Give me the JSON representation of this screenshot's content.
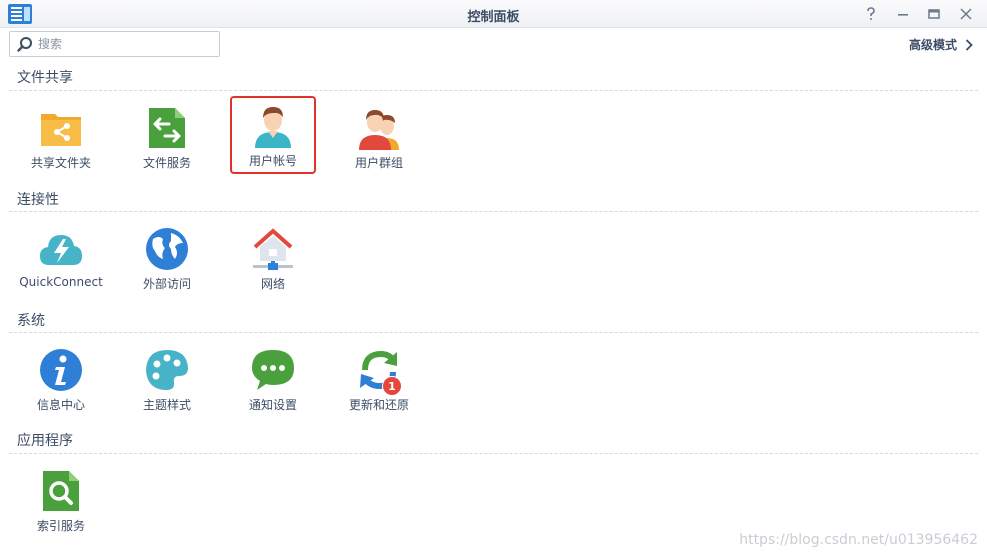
{
  "window": {
    "title": "控制面板"
  },
  "search": {
    "placeholder": "搜索"
  },
  "advanced_mode": {
    "label": "高级模式"
  },
  "sections": [
    {
      "title": "文件共享",
      "items": [
        {
          "label": "共享文件夹",
          "icon": "shared-folder-icon"
        },
        {
          "label": "文件服务",
          "icon": "file-services-icon"
        },
        {
          "label": "用户帐号",
          "icon": "user-icon",
          "selected": true
        },
        {
          "label": "用户群组",
          "icon": "group-icon"
        }
      ]
    },
    {
      "title": "连接性",
      "items": [
        {
          "label": "QuickConnect",
          "icon": "quickconnect-icon"
        },
        {
          "label": "外部访问",
          "icon": "globe-icon"
        },
        {
          "label": "网络",
          "icon": "network-icon"
        }
      ]
    },
    {
      "title": "系统",
      "items": [
        {
          "label": "信息中心",
          "icon": "info-icon"
        },
        {
          "label": "主题样式",
          "icon": "palette-icon"
        },
        {
          "label": "通知设置",
          "icon": "notification-icon"
        },
        {
          "label": "更新和还原",
          "icon": "update-restore-icon",
          "badge": "1"
        }
      ]
    },
    {
      "title": "应用程序",
      "items": [
        {
          "label": "索引服务",
          "icon": "indexing-service-icon"
        }
      ]
    }
  ],
  "watermark": "https://blog.csdn.net/u013956462",
  "colors": {
    "selected_border": "#e1312a",
    "title_text": "#3d4d66"
  }
}
